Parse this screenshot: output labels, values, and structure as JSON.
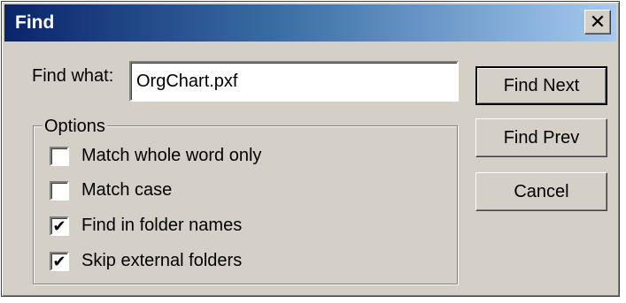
{
  "dialog": {
    "title": "Find",
    "close_glyph": "✕"
  },
  "find": {
    "label": "Find what:",
    "value": "OrgChart.pxf"
  },
  "options": {
    "legend": "Options",
    "items": [
      {
        "label": "Match whole word only",
        "checked": false
      },
      {
        "label": "Match case",
        "checked": false
      },
      {
        "label": "Find in folder names",
        "checked": true
      },
      {
        "label": "Skip external folders",
        "checked": true
      }
    ]
  },
  "buttons": {
    "find_next": "Find Next",
    "find_prev": "Find Prev",
    "cancel": "Cancel"
  },
  "colors": {
    "title_gradient_start": "#0a246a",
    "title_gradient_end": "#a6caf0",
    "face": "#d4d0c8"
  }
}
